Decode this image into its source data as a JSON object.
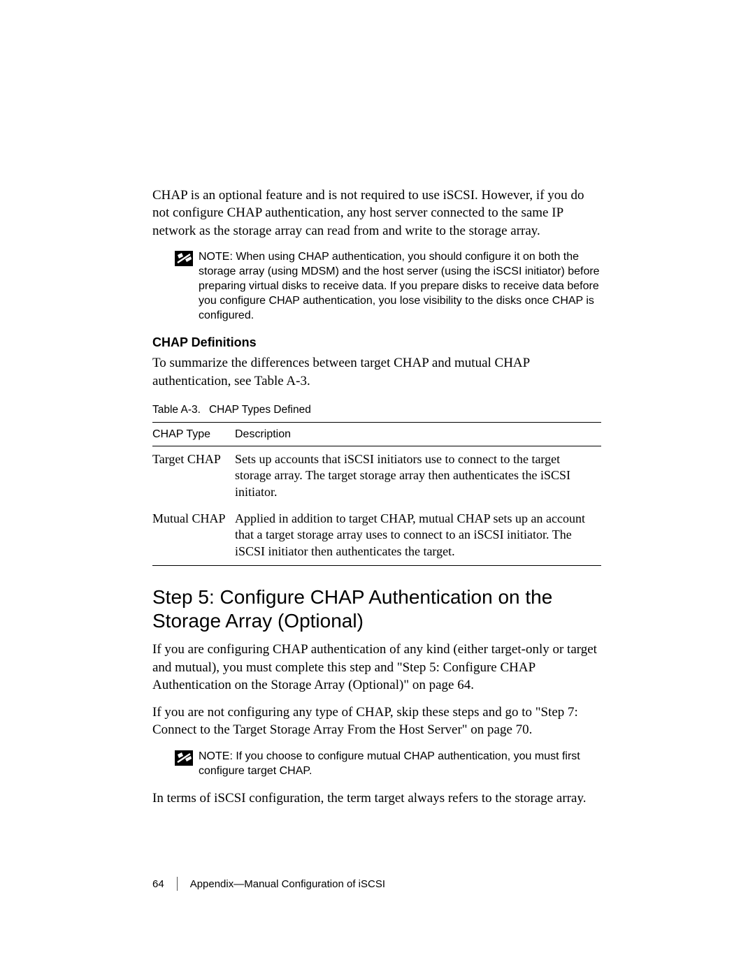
{
  "intro": "CHAP is an optional feature and is not required to use iSCSI. However, if you do not configure CHAP authentication, any host server connected to the same IP network as the storage array can read from and write to the storage array.",
  "note1_prefix": "NOTE:",
  "note1_text": "When using CHAP authentication, you should configure it on both the storage array (using MDSM) and the host server (using the iSCSI initiator) before preparing virtual disks to receive data. If you prepare disks to receive data before you configure CHAP authentication, you lose visibility to the disks once CHAP is configured.",
  "subhead": "CHAP Definitions",
  "definitions_intro": "To summarize the differences between target CHAP and mutual CHAP authentication, see Table A-3.",
  "table_caption_num": "Table A-3.",
  "table_caption_title": "CHAP Types Defined",
  "table_header_col1": "CHAP Type",
  "table_header_col2": "Description",
  "table_rows": [
    {
      "type": "Target CHAP",
      "desc": "Sets up accounts that iSCSI initiators use to connect to the target storage array. The target storage array then authenticates the iSCSI initiator."
    },
    {
      "type": "Mutual CHAP",
      "desc": "Applied in addition to target CHAP, mutual CHAP sets up an account that a target storage array uses to connect to an iSCSI initiator. The iSCSI initiator then authenticates the target."
    }
  ],
  "section_heading": "Step 5: Configure CHAP Authentication on the Storage Array (Optional)",
  "para_config": "If you are configuring CHAP authentication of any kind (either target-only or target and mutual), you must complete this step and \"Step 5: Configure CHAP Authentication on the Storage Array (Optional)\" on page 64.",
  "para_skip": "If you are not configuring any type of CHAP, skip these steps and go to \"Step 7: Connect to the Target Storage Array From the Host Server\" on page 70.",
  "note2_prefix": "NOTE:",
  "note2_text": "If you choose to configure mutual CHAP authentication, you must first configure target CHAP.",
  "para_target": "In terms of iSCSI configuration, the term target always refers to the storage array.",
  "footer_page": "64",
  "footer_section": "Appendix—Manual Configuration of iSCSI"
}
